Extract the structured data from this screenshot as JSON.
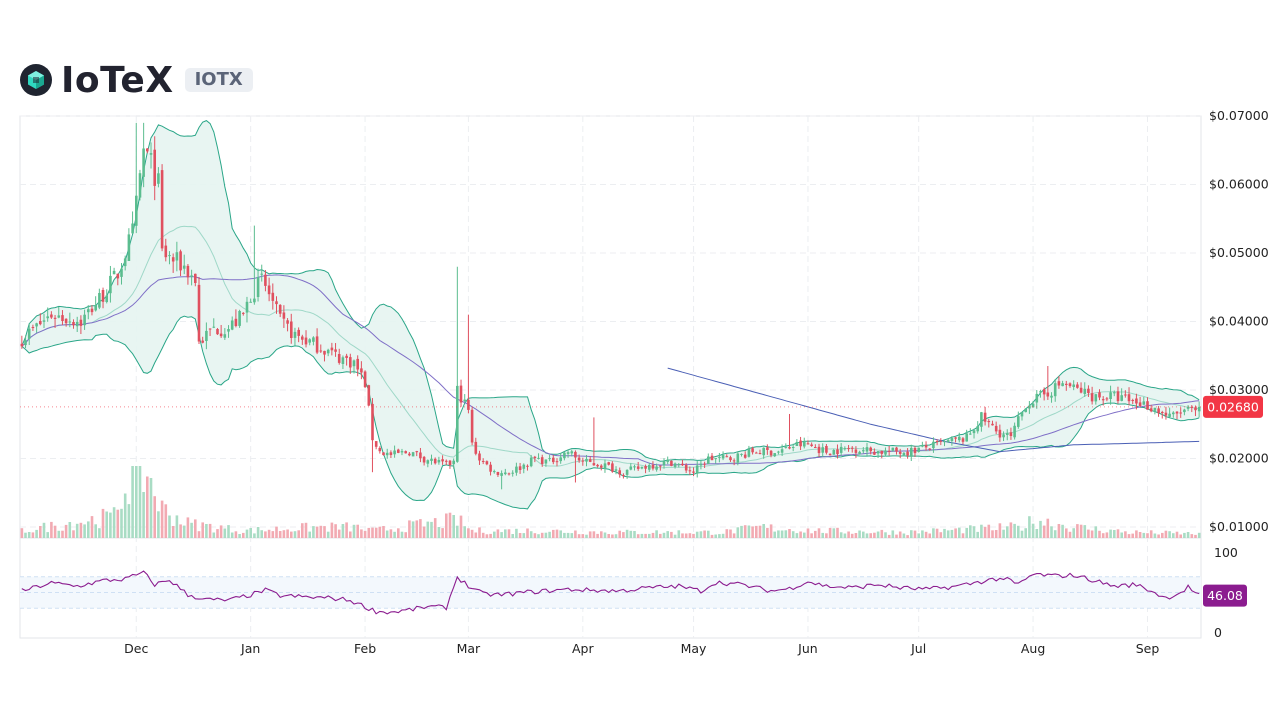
{
  "header": {
    "title": "IoTeX",
    "ticker": "IOTX",
    "logo_icon": "iotex-cube-logo-icon"
  },
  "colors": {
    "up": "#5bbd8f",
    "down": "#e0505f",
    "bollinger": "#2aa688",
    "bollinger_fill": "#e6f4f1",
    "ma_long": "#4a5fb5",
    "ma_mid": "#7f6fc7",
    "rsi": "#8b1c8f",
    "price_tag": "#f23645",
    "rsi_tag": "#8b1c8f"
  },
  "price_tag": "0.02680",
  "rsi_tag": "46.08",
  "chart_data": {
    "type": "candlestick",
    "ylim": [
      0.009,
      0.07
    ],
    "y_ticks": [
      "$0.07000",
      "$0.06000",
      "$0.05000",
      "$0.04000",
      "$0.03000",
      "$0.02000",
      "$0.01000"
    ],
    "y_tick_values": [
      0.07,
      0.06,
      0.05,
      0.04,
      0.03,
      0.02,
      0.01
    ],
    "x_ticks": [
      "Dec",
      "Jan",
      "Feb",
      "Mar",
      "Apr",
      "May",
      "Jun",
      "Jul",
      "Aug",
      "Sep"
    ],
    "x_tick_day_index": [
      31,
      62,
      93,
      121,
      152,
      182,
      213,
      243,
      274,
      305
    ],
    "days": 320,
    "close_anchors": [
      [
        0,
        0.0375
      ],
      [
        8,
        0.041
      ],
      [
        16,
        0.04
      ],
      [
        22,
        0.044
      ],
      [
        26,
        0.047
      ],
      [
        30,
        0.053
      ],
      [
        31,
        0.057
      ],
      [
        33,
        0.065
      ],
      [
        35,
        0.063
      ],
      [
        37,
        0.06
      ],
      [
        38,
        0.05
      ],
      [
        41,
        0.049
      ],
      [
        44,
        0.048
      ],
      [
        47,
        0.046
      ],
      [
        48,
        0.037
      ],
      [
        52,
        0.039
      ],
      [
        56,
        0.039
      ],
      [
        60,
        0.041
      ],
      [
        62,
        0.044
      ],
      [
        65,
        0.046
      ],
      [
        67,
        0.044
      ],
      [
        70,
        0.04
      ],
      [
        74,
        0.038
      ],
      [
        78,
        0.037
      ],
      [
        82,
        0.036
      ],
      [
        85,
        0.035
      ],
      [
        90,
        0.034
      ],
      [
        93,
        0.031
      ],
      [
        95,
        0.023
      ],
      [
        97,
        0.021
      ],
      [
        100,
        0.0205
      ],
      [
        105,
        0.021
      ],
      [
        109,
        0.02
      ],
      [
        115,
        0.019
      ],
      [
        117,
        0.0195
      ],
      [
        118,
        0.03
      ],
      [
        119,
        0.029
      ],
      [
        121,
        0.027
      ],
      [
        122,
        0.022
      ],
      [
        124,
        0.02
      ],
      [
        128,
        0.018
      ],
      [
        132,
        0.018
      ],
      [
        136,
        0.019
      ],
      [
        139,
        0.02
      ],
      [
        143,
        0.0195
      ],
      [
        148,
        0.021
      ],
      [
        152,
        0.0195
      ],
      [
        158,
        0.019
      ],
      [
        163,
        0.018
      ],
      [
        170,
        0.019
      ],
      [
        176,
        0.0195
      ],
      [
        182,
        0.018
      ],
      [
        186,
        0.02
      ],
      [
        192,
        0.02
      ],
      [
        198,
        0.021
      ],
      [
        205,
        0.021
      ],
      [
        210,
        0.022
      ],
      [
        213,
        0.022
      ],
      [
        218,
        0.021
      ],
      [
        225,
        0.0215
      ],
      [
        232,
        0.021
      ],
      [
        240,
        0.021
      ],
      [
        248,
        0.022
      ],
      [
        256,
        0.023
      ],
      [
        260,
        0.026
      ],
      [
        264,
        0.024
      ],
      [
        268,
        0.023
      ],
      [
        272,
        0.028
      ],
      [
        276,
        0.029
      ],
      [
        282,
        0.031
      ],
      [
        286,
        0.03
      ],
      [
        291,
        0.029
      ],
      [
        296,
        0.029
      ],
      [
        300,
        0.0285
      ],
      [
        304,
        0.028
      ],
      [
        308,
        0.027
      ],
      [
        311,
        0.026
      ],
      [
        315,
        0.027
      ],
      [
        319,
        0.0268
      ]
    ],
    "volume_anchors": [
      [
        0,
        1
      ],
      [
        25,
        3
      ],
      [
        30,
        10
      ],
      [
        34,
        9
      ],
      [
        38,
        4
      ],
      [
        45,
        2
      ],
      [
        60,
        1
      ],
      [
        80,
        1.5
      ],
      [
        90,
        1.5
      ],
      [
        95,
        1
      ],
      [
        118,
        2.5
      ],
      [
        122,
        1
      ],
      [
        140,
        1
      ],
      [
        160,
        0.8
      ],
      [
        190,
        0.8
      ],
      [
        200,
        1.5
      ],
      [
        215,
        1
      ],
      [
        240,
        0.8
      ],
      [
        270,
        1.5
      ],
      [
        275,
        2.5
      ],
      [
        285,
        1.5
      ],
      [
        300,
        0.8
      ],
      [
        319,
        0.6
      ]
    ],
    "rsi_ylim": [
      0,
      100
    ],
    "rsi_ticks": [
      "100",
      "0"
    ],
    "rsi_anchors": [
      [
        0,
        52
      ],
      [
        8,
        62
      ],
      [
        15,
        58
      ],
      [
        22,
        65
      ],
      [
        28,
        67
      ],
      [
        31,
        72
      ],
      [
        33,
        75
      ],
      [
        36,
        60
      ],
      [
        40,
        66
      ],
      [
        45,
        47
      ],
      [
        50,
        41
      ],
      [
        56,
        40
      ],
      [
        62,
        47
      ],
      [
        66,
        53
      ],
      [
        70,
        46
      ],
      [
        78,
        44
      ],
      [
        84,
        43
      ],
      [
        89,
        40
      ],
      [
        92,
        34
      ],
      [
        96,
        26
      ],
      [
        100,
        25
      ],
      [
        105,
        28
      ],
      [
        110,
        32
      ],
      [
        115,
        31
      ],
      [
        118,
        70
      ],
      [
        121,
        58
      ],
      [
        125,
        48
      ],
      [
        130,
        47
      ],
      [
        136,
        50
      ],
      [
        142,
        52
      ],
      [
        148,
        54
      ],
      [
        154,
        53
      ],
      [
        162,
        52
      ],
      [
        170,
        56
      ],
      [
        178,
        58
      ],
      [
        184,
        52
      ],
      [
        188,
        63
      ],
      [
        195,
        60
      ],
      [
        203,
        52
      ],
      [
        208,
        55
      ],
      [
        213,
        64
      ],
      [
        218,
        58
      ],
      [
        225,
        56
      ],
      [
        232,
        60
      ],
      [
        238,
        56
      ],
      [
        245,
        54
      ],
      [
        252,
        57
      ],
      [
        258,
        62
      ],
      [
        262,
        66
      ],
      [
        266,
        68
      ],
      [
        270,
        60
      ],
      [
        274,
        73
      ],
      [
        280,
        71
      ],
      [
        285,
        72
      ],
      [
        290,
        66
      ],
      [
        296,
        58
      ],
      [
        302,
        60
      ],
      [
        306,
        52
      ],
      [
        310,
        43
      ],
      [
        314,
        50
      ],
      [
        316,
        57
      ],
      [
        319,
        46
      ]
    ],
    "ma_long_segment": [
      175,
      319
    ],
    "ma_long_anchors": [
      [
        175,
        0.0332
      ],
      [
        230,
        0.025
      ],
      [
        250,
        0.0225
      ],
      [
        265,
        0.021
      ],
      [
        285,
        0.022
      ],
      [
        300,
        0.0222
      ],
      [
        319,
        0.0225
      ]
    ]
  }
}
